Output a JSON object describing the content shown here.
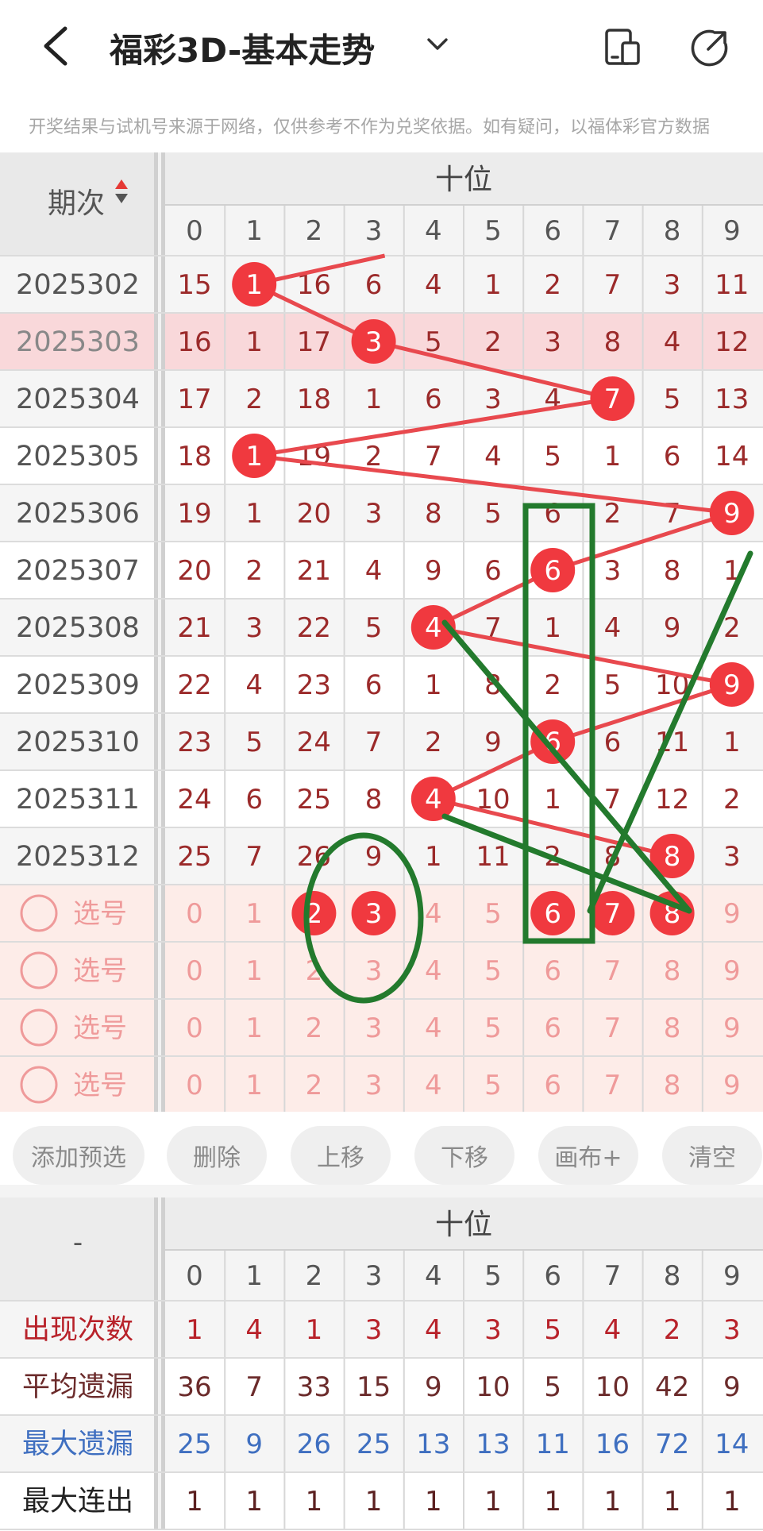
{
  "header": {
    "title": "福彩3D-基本走势",
    "back_icon": "chevron-left-icon",
    "dropdown_icon": "chevron-down-icon",
    "icons": [
      "device-layout-icon",
      "share-icon"
    ]
  },
  "notice": "开奖结果与试机号来源于网络，仅供参考不作为兑奖依据。如有疑问，以福体彩官方数据",
  "trend_table": {
    "period_header": "期次",
    "group_header": "十位",
    "digits": [
      "0",
      "1",
      "2",
      "3",
      "4",
      "5",
      "6",
      "7",
      "8",
      "9"
    ],
    "rows": [
      {
        "period": "2025302",
        "cells": [
          15,
          1,
          16,
          6,
          4,
          1,
          2,
          7,
          3,
          11
        ],
        "hit": 1,
        "highlight": false
      },
      {
        "period": "2025303",
        "cells": [
          16,
          1,
          17,
          3,
          5,
          2,
          3,
          8,
          4,
          12
        ],
        "hit": 3,
        "highlight": true
      },
      {
        "period": "2025304",
        "cells": [
          17,
          2,
          18,
          1,
          6,
          3,
          4,
          7,
          5,
          13
        ],
        "hit": 7,
        "highlight": false
      },
      {
        "period": "2025305",
        "cells": [
          18,
          1,
          19,
          2,
          7,
          4,
          5,
          1,
          6,
          14
        ],
        "hit": 1,
        "highlight": false
      },
      {
        "period": "2025306",
        "cells": [
          19,
          1,
          20,
          3,
          8,
          5,
          6,
          2,
          7,
          9
        ],
        "hit": 9,
        "highlight": false
      },
      {
        "period": "2025307",
        "cells": [
          20,
          2,
          21,
          4,
          9,
          6,
          6,
          3,
          8,
          1
        ],
        "hit": 6,
        "highlight": false
      },
      {
        "period": "2025308",
        "cells": [
          21,
          3,
          22,
          5,
          4,
          7,
          1,
          4,
          9,
          2
        ],
        "hit": 4,
        "highlight": false
      },
      {
        "period": "2025309",
        "cells": [
          22,
          4,
          23,
          6,
          1,
          8,
          2,
          5,
          10,
          9
        ],
        "hit": 9,
        "highlight": false
      },
      {
        "period": "2025310",
        "cells": [
          23,
          5,
          24,
          7,
          2,
          9,
          6,
          6,
          11,
          1
        ],
        "hit": 6,
        "highlight": false
      },
      {
        "period": "2025311",
        "cells": [
          24,
          6,
          25,
          8,
          4,
          10,
          1,
          7,
          12,
          2
        ],
        "hit": 4,
        "highlight": false
      },
      {
        "period": "2025312",
        "cells": [
          25,
          7,
          26,
          9,
          1,
          11,
          2,
          8,
          8,
          3
        ],
        "hit": 8,
        "highlight": false
      }
    ],
    "select_label": "选号",
    "select_rows": [
      {
        "selected": [
          2,
          3,
          6,
          7,
          8
        ]
      },
      {
        "selected": []
      },
      {
        "selected": []
      },
      {
        "selected": []
      }
    ]
  },
  "actions": [
    "添加预选",
    "删除",
    "上移",
    "下移",
    "画布+",
    "清空"
  ],
  "stats_table": {
    "corner": "-",
    "group_header": "十位",
    "rows": [
      {
        "label": "出现次数",
        "values": [
          1,
          4,
          1,
          3,
          4,
          3,
          5,
          4,
          2,
          3
        ],
        "style": "red"
      },
      {
        "label": "平均遗漏",
        "values": [
          36,
          7,
          33,
          15,
          9,
          10,
          5,
          10,
          42,
          9
        ],
        "style": "brown"
      },
      {
        "label": "最大遗漏",
        "values": [
          25,
          9,
          26,
          25,
          13,
          13,
          11,
          16,
          72,
          14
        ],
        "style": "blue"
      },
      {
        "label": "最大连出",
        "values": [
          1,
          1,
          1,
          1,
          1,
          1,
          1,
          1,
          1,
          1
        ],
        "style": "dark"
      }
    ]
  },
  "colors": {
    "ball": "#f0393f",
    "trend_line": "#e8494e",
    "number": "#9b2a2a",
    "period": "#555555",
    "highlight_row": "#f9d8da",
    "select_bg": "#fdece8",
    "select_number": "#ef9a9a",
    "annotation": "#237a2d",
    "stat_red": "#b8222a",
    "stat_blue": "#3f6fc0",
    "stat_brown": "#6b2b2b"
  }
}
